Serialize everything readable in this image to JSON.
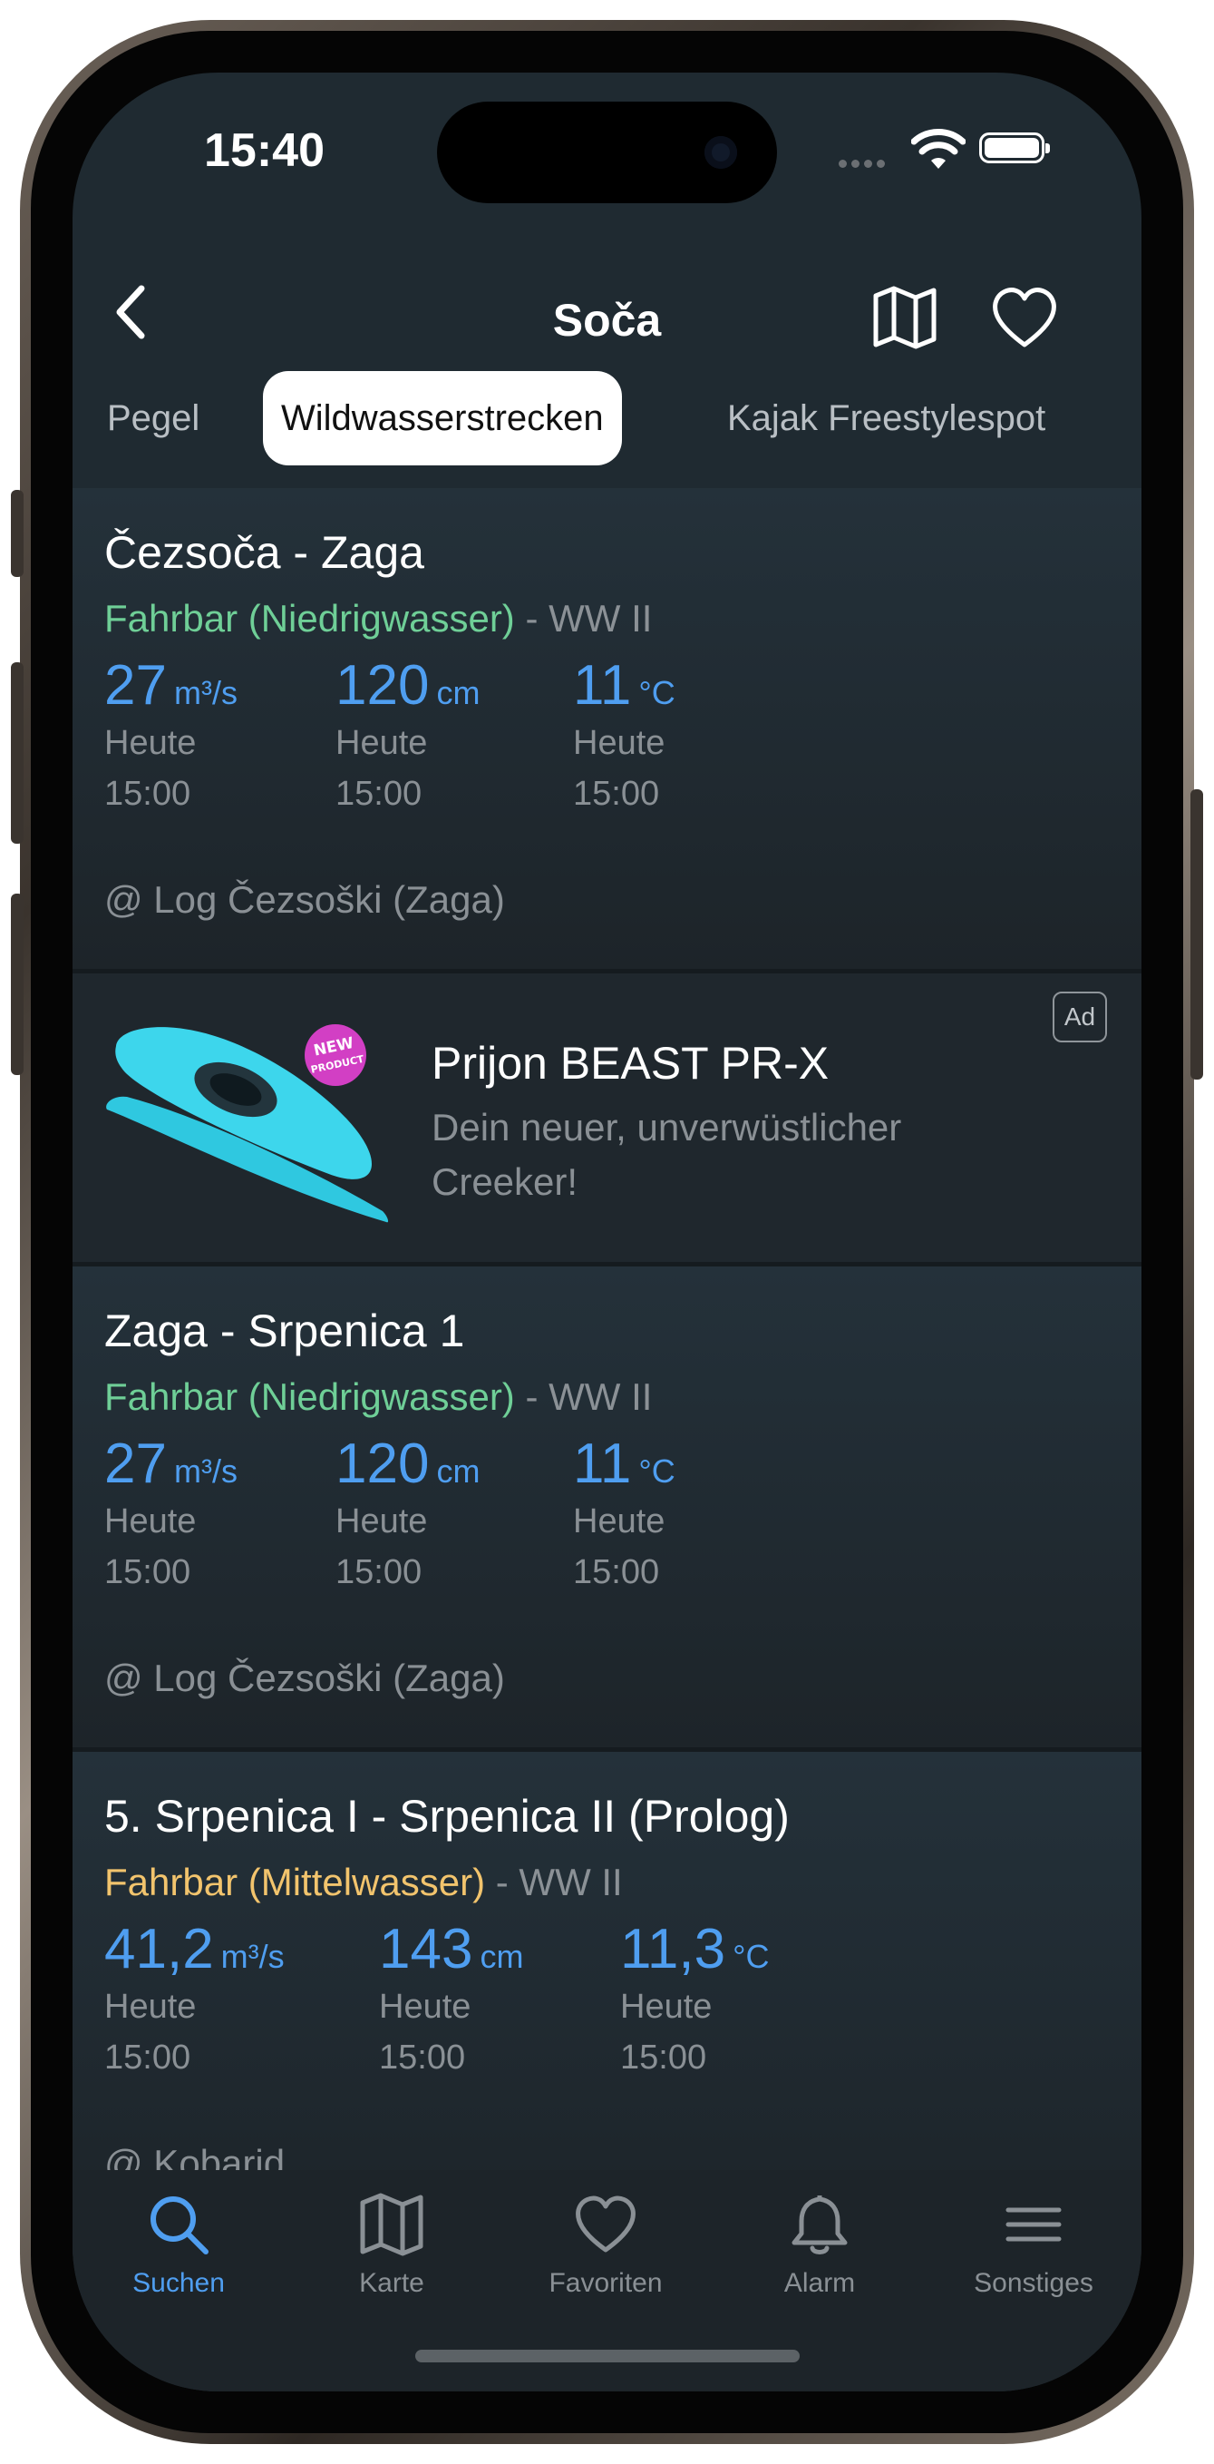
{
  "status_bar": {
    "time": "15:40"
  },
  "header": {
    "title": "Soča"
  },
  "tabs": [
    {
      "label": "Pegel"
    },
    {
      "label": "Wildwasserstrecken",
      "active": true
    },
    {
      "label": "Kajak Freestylespot"
    }
  ],
  "runs": [
    {
      "title": "Čezsoča - Zaga",
      "status": "Fahrbar (Niedrigwasser)",
      "status_color": "#6fcf97",
      "grade": "- WW II",
      "metrics": [
        {
          "value": "27",
          "unit": "m³/s",
          "day": "Heute",
          "time": "15:00"
        },
        {
          "value": "120",
          "unit": "cm",
          "day": "Heute",
          "time": "15:00"
        },
        {
          "value": "11",
          "unit": "°C",
          "day": "Heute",
          "time": "15:00"
        }
      ],
      "gauge": "@ Log Čezsoški (Zaga)"
    },
    {
      "title": "Zaga - Srpenica 1",
      "status": "Fahrbar (Niedrigwasser)",
      "status_color": "#6fcf97",
      "grade": "- WW II",
      "metrics": [
        {
          "value": "27",
          "unit": "m³/s",
          "day": "Heute",
          "time": "15:00"
        },
        {
          "value": "120",
          "unit": "cm",
          "day": "Heute",
          "time": "15:00"
        },
        {
          "value": "11",
          "unit": "°C",
          "day": "Heute",
          "time": "15:00"
        }
      ],
      "gauge": "@ Log Čezsoški (Zaga)"
    },
    {
      "title": "5. Srpenica I - Srpenica II (Prolog)",
      "status": "Fahrbar (Mittelwasser)",
      "status_color": "#f2c46d",
      "grade": "- WW II",
      "metrics": [
        {
          "value": "41,2",
          "unit": "m³/s",
          "day": "Heute",
          "time": "15:00"
        },
        {
          "value": "143",
          "unit": "cm",
          "day": "Heute",
          "time": "15:00"
        },
        {
          "value": "11,3",
          "unit": "°C",
          "day": "Heute",
          "time": "15:00"
        }
      ],
      "gauge": "@ Kobarid"
    }
  ],
  "ad": {
    "title": "Prijon BEAST PR-X",
    "description": "Dein neuer, unverwüstlicher Creeker!",
    "badge": "Ad",
    "image_sticker": "NEW PRODUCT"
  },
  "tabbar": [
    {
      "label": "Suchen",
      "icon": "search-icon",
      "active": true
    },
    {
      "label": "Karte",
      "icon": "map-icon"
    },
    {
      "label": "Favoriten",
      "icon": "heart-icon"
    },
    {
      "label": "Alarm",
      "icon": "bell-icon"
    },
    {
      "label": "Sonstiges",
      "icon": "menu-icon"
    }
  ],
  "colors": {
    "accent": "#4f9ef0",
    "background": "#1f2a31",
    "status_low_water": "#6fcf97",
    "status_mid_water": "#f2c46d"
  }
}
